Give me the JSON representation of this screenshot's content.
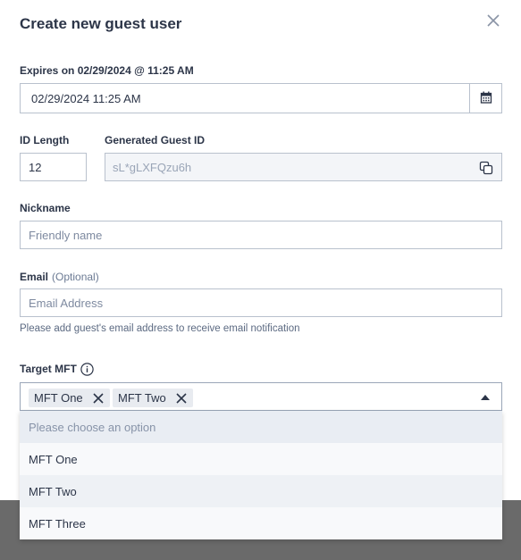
{
  "dialog": {
    "title": "Create new guest user"
  },
  "expires": {
    "label": "Expires on 02/29/2024 @ 11:25 AM",
    "value": "02/29/2024 11:25 AM"
  },
  "id_length": {
    "label": "ID Length",
    "value": "12"
  },
  "guest_id": {
    "label": "Generated Guest ID",
    "value": "sL*gLXFQzu6h"
  },
  "nickname": {
    "label": "Nickname",
    "placeholder": "Friendly name"
  },
  "email": {
    "label": "Email",
    "optional": "(Optional)",
    "placeholder": "Email Address",
    "help": "Please add guest's email address to receive email notification"
  },
  "target_mft": {
    "label": "Target MFT",
    "selected": [
      "MFT One",
      "MFT Two"
    ],
    "options": [
      "Please choose an option",
      "MFT One",
      "MFT Two",
      "MFT Three"
    ]
  }
}
